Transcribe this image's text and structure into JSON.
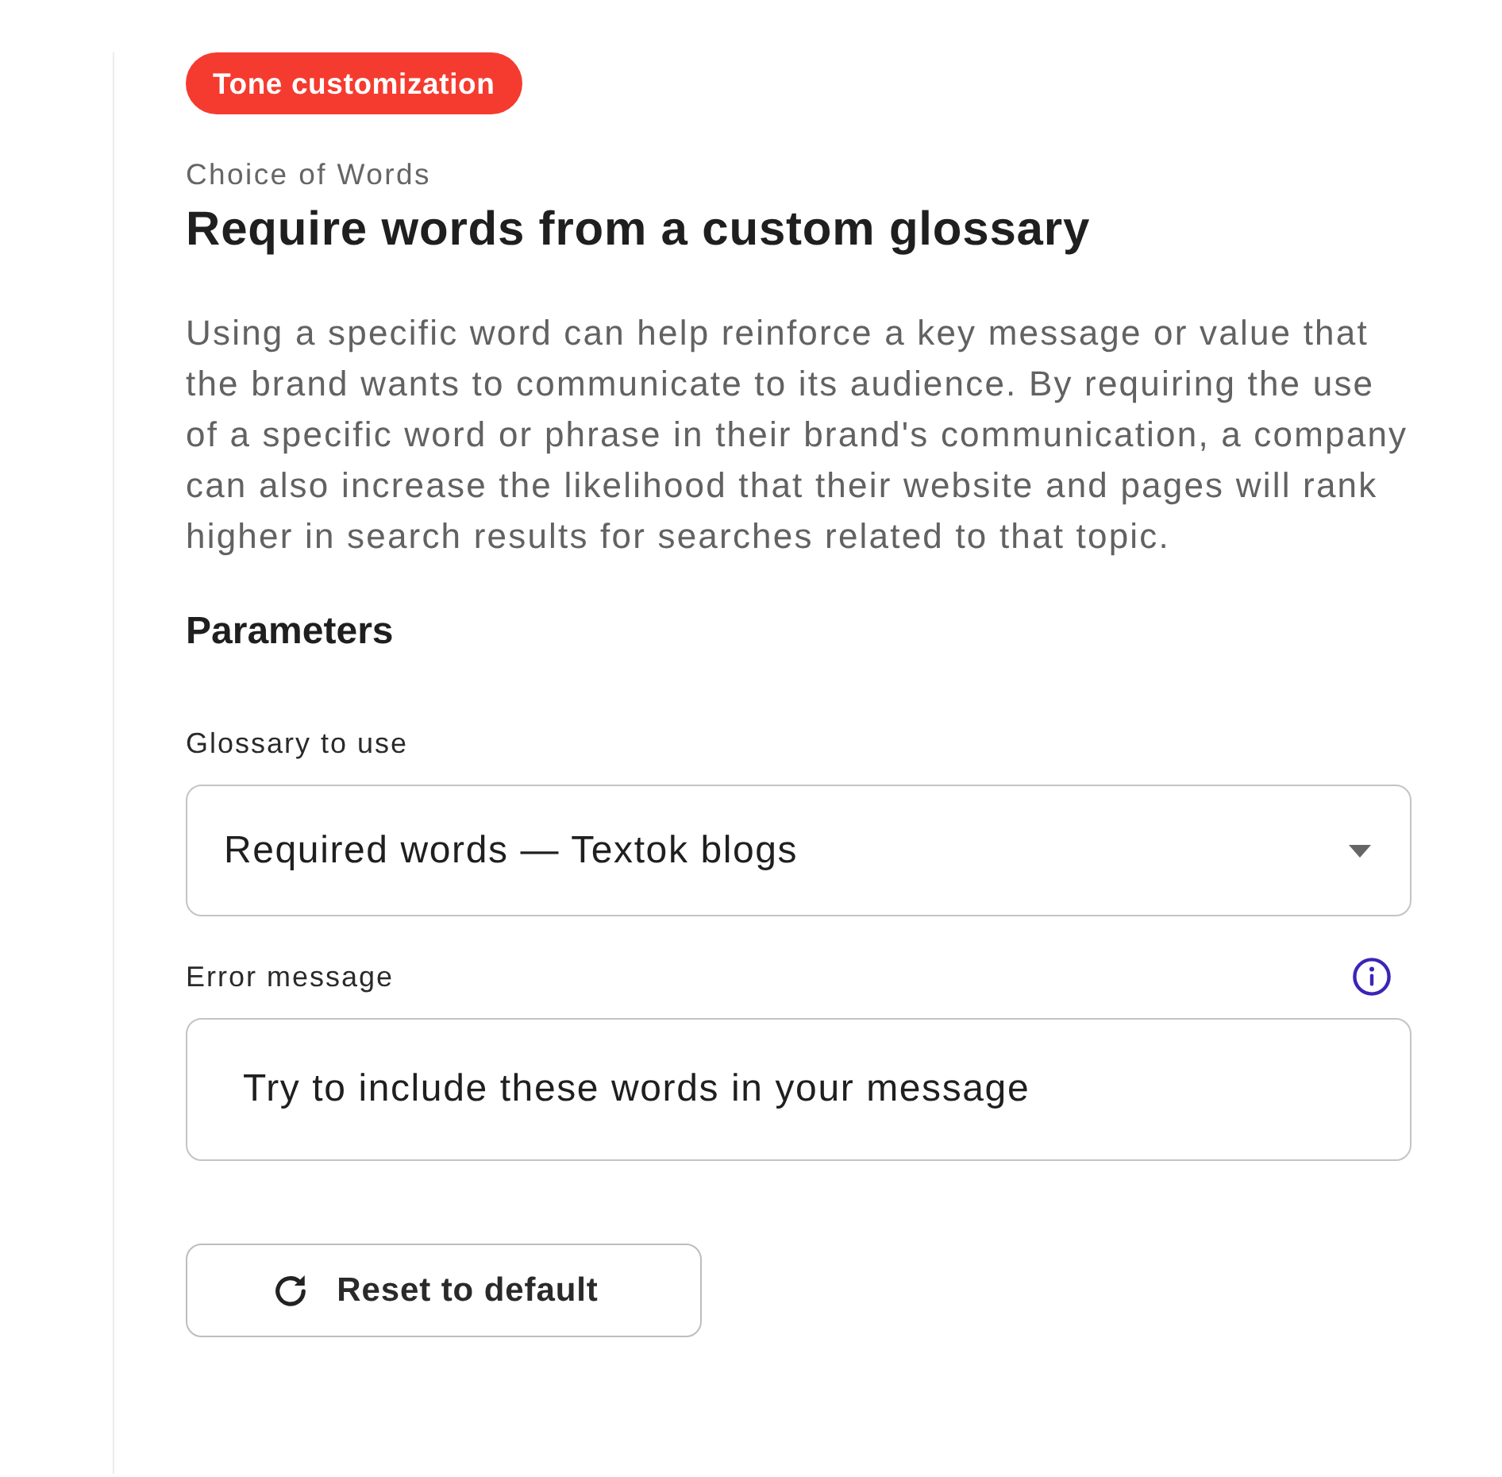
{
  "badge": {
    "label": "Tone customization"
  },
  "category": "Choice of Words",
  "title": "Require words from a custom glossary",
  "description": "Using a specific word can help reinforce a key message or value that the brand wants to communicate to its audience. By requiring the use of a specific word or phrase in their brand's communication, a company can also increase the likelihood that their website and pages will rank higher in search results for searches related to that topic.",
  "parameters": {
    "heading": "Parameters",
    "fields": [
      {
        "kind": "select",
        "label": "Glossary to use",
        "value": "Required words — Textok blogs",
        "info": false
      },
      {
        "kind": "text",
        "label": "Error message",
        "value": "Try to include these words in your message",
        "info": true
      }
    ]
  },
  "reset_button": {
    "label": "Reset to default"
  }
}
